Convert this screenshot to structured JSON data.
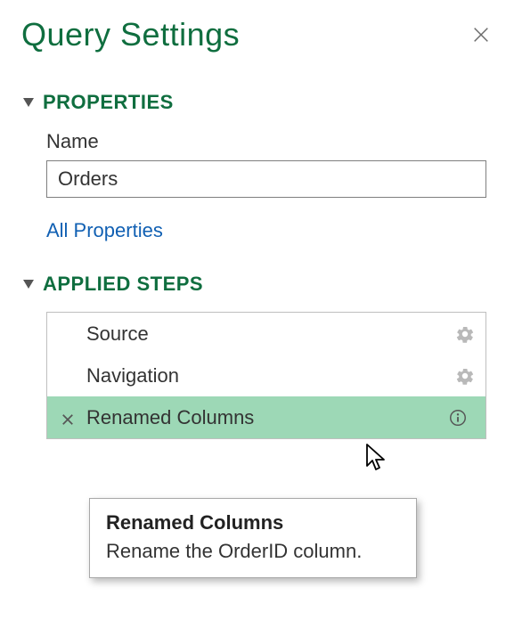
{
  "panel": {
    "title": "Query Settings"
  },
  "sections": {
    "properties": {
      "heading": "PROPERTIES",
      "name_label": "Name",
      "name_value": "Orders",
      "all_properties_link": "All Properties"
    },
    "applied_steps": {
      "heading": "APPLIED STEPS",
      "steps": [
        {
          "label": "Source",
          "has_gear": true,
          "selected": false
        },
        {
          "label": "Navigation",
          "has_gear": true,
          "selected": false
        },
        {
          "label": "Renamed Columns",
          "has_gear": false,
          "selected": true,
          "has_info": true
        }
      ]
    }
  },
  "tooltip": {
    "title": "Renamed Columns",
    "description": "Rename the OrderID column."
  }
}
